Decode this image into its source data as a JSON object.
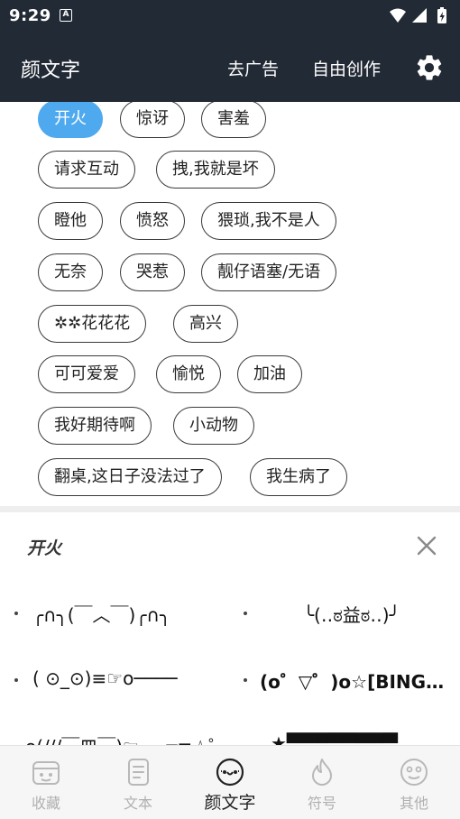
{
  "status_bar": {
    "time": "9:29",
    "notification_icon": "A"
  },
  "app_bar": {
    "title": "颜文字",
    "remove_ads_label": "去广告",
    "free_create_label": "自由创作",
    "settings_icon": "gear-icon"
  },
  "tags": [
    "开火",
    "惊讶",
    "害羞",
    "请求互动",
    "拽,我就是坏",
    "瞪他",
    "愤怒",
    "猥琐,我不是人",
    "无奈",
    "哭惹",
    "靓仔语塞/无语",
    "✲✲花花花",
    "高兴",
    "可可爱爱",
    "愉悦",
    "加油",
    "我好期待啊",
    "小动物",
    "翻桌,这日子没法过了",
    "我生病了"
  ],
  "selected_tag": "开火",
  "panel": {
    "title": "开火",
    "close_icon": "close-icon",
    "faces": [
      "╭∩╮(￣︿￣)╭∩╮",
      "╰(‥ಠ益ಠ‥)╯",
      "( ⊙_⊙)≡☞o────",
      "(o゜▽゜)o☆[BINGO!]",
      "o(///￣皿￣)☞ ──═≡☆゜",
      "★▀▀▀▀▀▀▀▀"
    ]
  },
  "bottom_nav": [
    {
      "label": "收藏",
      "icon": "favorites-box-icon"
    },
    {
      "label": "文本",
      "icon": "document-icon"
    },
    {
      "label": "颜文字",
      "icon": "kaomoji-face-icon"
    },
    {
      "label": "符号",
      "icon": "flame-icon"
    },
    {
      "label": "其他",
      "icon": "emoji-face-icon"
    }
  ],
  "active_nav": "颜文字",
  "colors": {
    "header_bg": "#222a36",
    "accent": "#4fa9ee"
  }
}
